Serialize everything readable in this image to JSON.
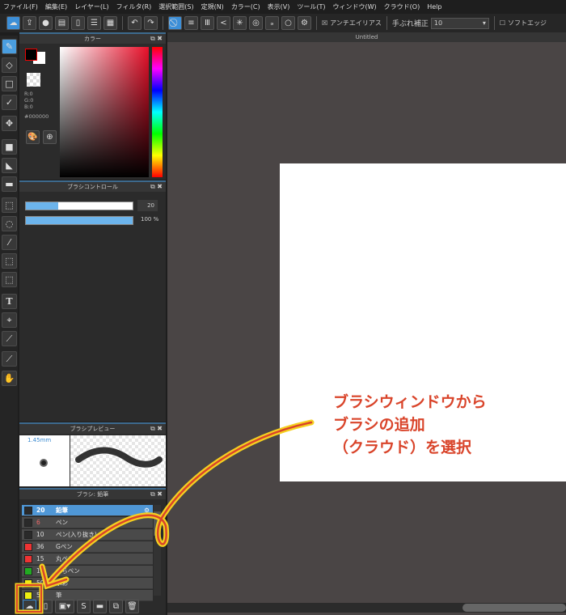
{
  "menu": [
    "ファイル(F)",
    "編集(E)",
    "レイヤー(L)",
    "フィルタ(R)",
    "選択範囲(S)",
    "定規(N)",
    "カラー(C)",
    "表示(V)",
    "ツール(T)",
    "ウィンドウ(W)",
    "クラウド(O)",
    "Help"
  ],
  "toolbar": {
    "antialias": "アンチエイリアス",
    "stabilizer_label": "手ぶれ補正",
    "stabilizer_value": "10",
    "soft_edge": "ソフトエッジ"
  },
  "document": {
    "title": "Untitled"
  },
  "color_panel": {
    "title": "カラー",
    "r": "R:0",
    "g": "G:0",
    "b": "B:0",
    "hex": "#000000",
    "primary": "#000000",
    "secondary": "#ffffff"
  },
  "brush_control": {
    "title": "ブラシコントロール",
    "size": "20",
    "size_fraction": 0.3,
    "opacity": "100 %",
    "opacity_fraction": 1.0
  },
  "brush_preview": {
    "title": "ブラシプレビュー",
    "size": "1.45mm"
  },
  "brush_list": {
    "title": "ブラシ: 鉛筆",
    "items": [
      {
        "size": "20",
        "name": "鉛筆",
        "color": "#2a2a2a"
      },
      {
        "size": "6",
        "name": "ペン",
        "color": "#2a2a2a"
      },
      {
        "size": "10",
        "name": "ペン(入り抜き)",
        "color": "#2a2a2a"
      },
      {
        "size": "36",
        "name": "Gペン",
        "color": "#ee3333"
      },
      {
        "size": "15",
        "name": "丸ペン",
        "color": "#ee3333"
      },
      {
        "size": "10",
        "name": "ふちペン",
        "color": "#22aa22"
      },
      {
        "size": "50",
        "name": "水彩",
        "color": "#eeee11"
      },
      {
        "size": "5",
        "name": "筆",
        "color": "#eeee11"
      }
    ]
  },
  "annotation": {
    "lines": [
      "ブラシウィンドウから",
      "ブラシの追加",
      "（クラウド）を選択"
    ],
    "color": "#d9442a"
  }
}
